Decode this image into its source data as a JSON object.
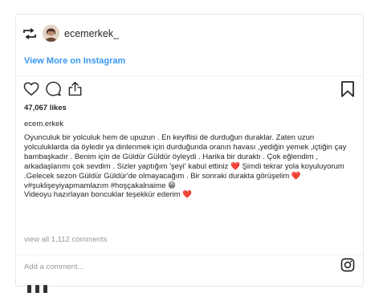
{
  "post": {
    "username": "ecemerkek_",
    "view_more": "View More on Instagram",
    "likes": "47,067 likes",
    "caption_user": "ecem.erkek",
    "caption": {
      "part1": "Oyunculuk bir yolculuk hem de upuzun . En keyiflisi de durduğun duraklar. Zaten uzun yolculuklarda da öyledir ya dinlenmek için durduğunda oranın havası ,yediğin yemek ,içtiğin çay bambaşkadır . Benim için de Güldür Güldür öyleydi . Harika bir duraktı . Çok eğlendim , arkadaşlarımı çok sevdim . Sizler yaptığım 'şeyi' kabul ettiniz ",
      "heart1": "❤️",
      "part2": " Şimdi tekrar yola koyuluyorum .Gelecek sezon Güldür Güldür'de olmayacağım . Bir sonraki durakta görüşelim ",
      "heart2": "❤️",
      "part3": " v#şuklişeyiyapmamlazım #hoşçakalnaime ",
      "emoji": "😁",
      "part4": "\nVideoyu hazırlayan boncuklar teşekkür ederim ",
      "heart3": "❤️"
    },
    "comments_link": "view all 1,112 comments",
    "add_comment_placeholder": "Add a comment..."
  },
  "colors": {
    "link": "#3897f0",
    "heart": "#e0245e",
    "muted": "#999999",
    "border": "#e6e6e6"
  },
  "icons": [
    "repost-icon",
    "avatar",
    "heart-icon",
    "comment-icon",
    "share-icon",
    "bookmark-icon",
    "instagram-icon"
  ]
}
